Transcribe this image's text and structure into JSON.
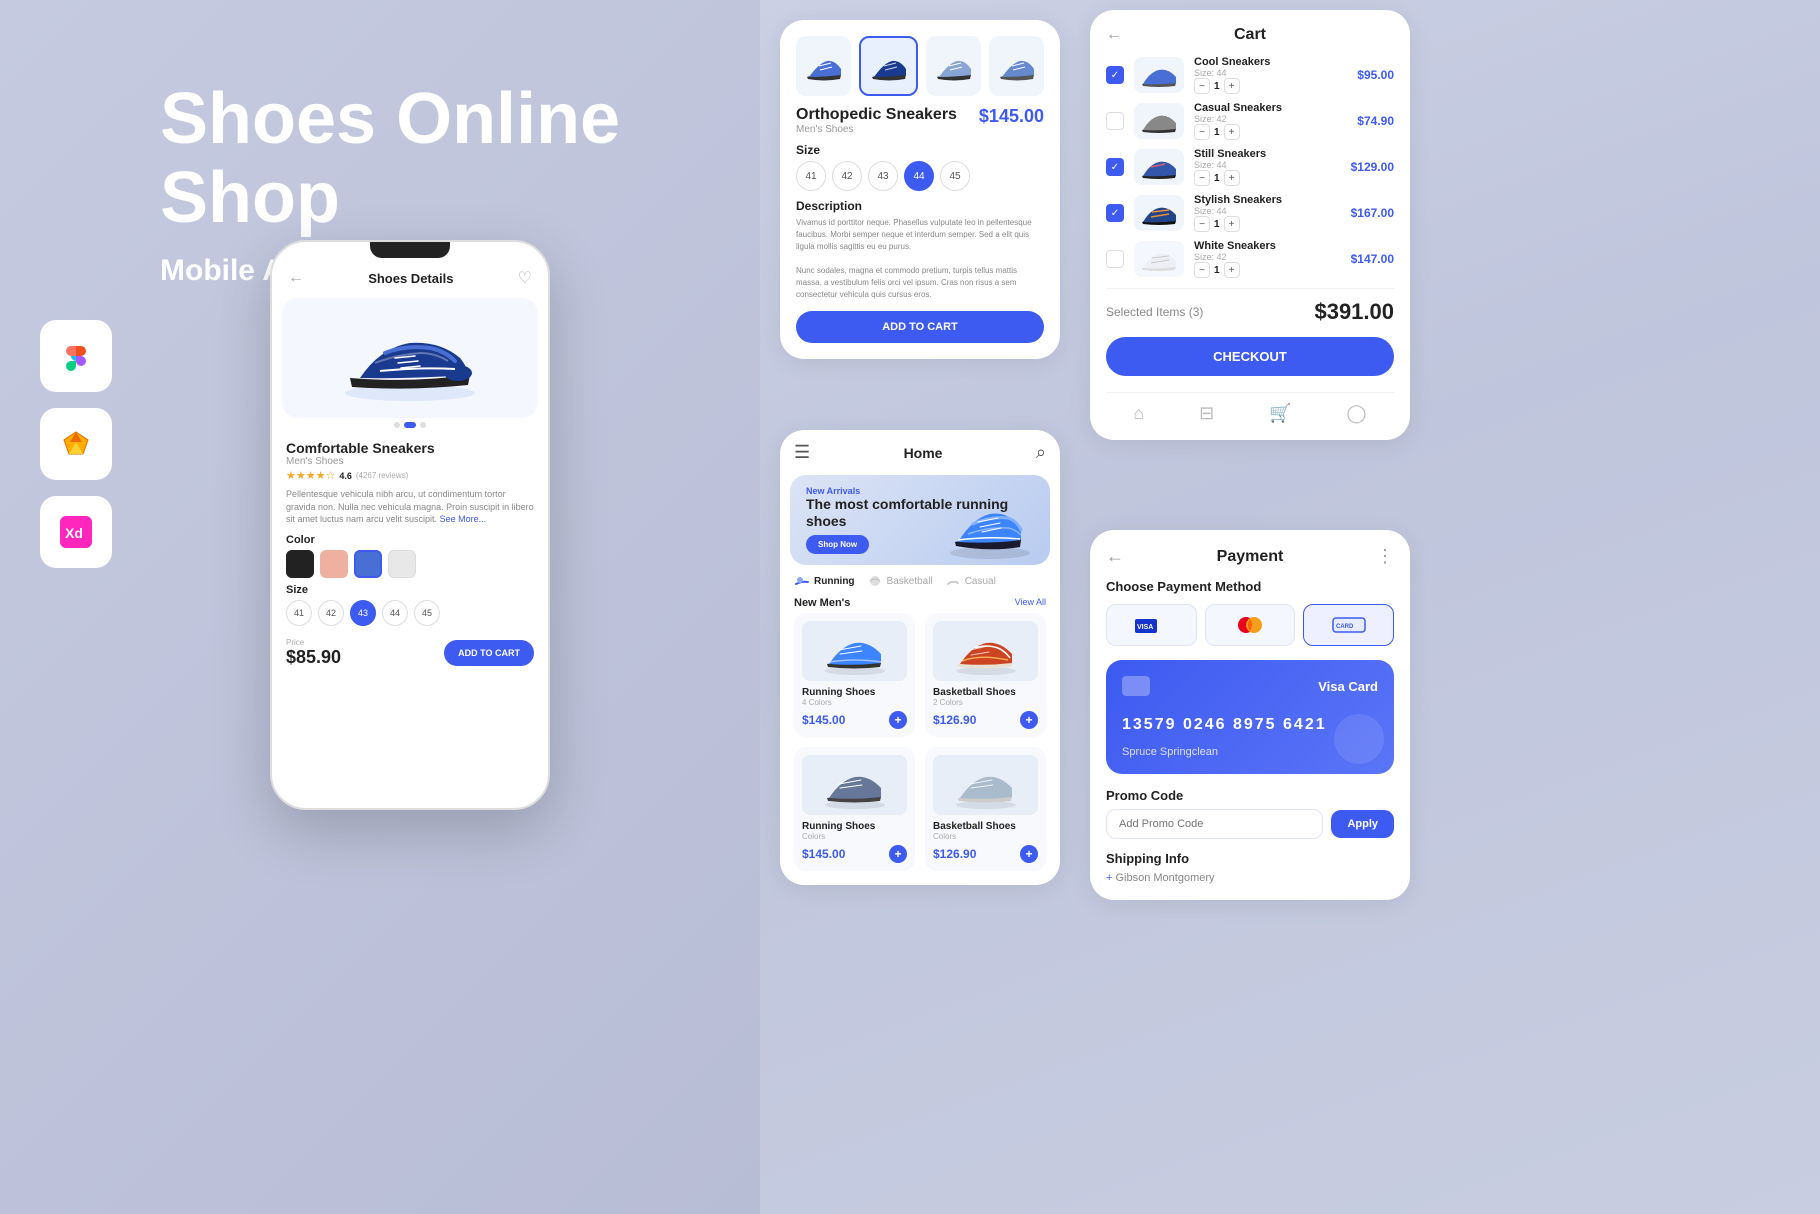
{
  "hero": {
    "title": "Shoes Online Shop",
    "subtitle": "Mobile App UI Kit"
  },
  "tools": [
    {
      "name": "Figma",
      "icon": "🎨",
      "class": "tool-figma"
    },
    {
      "name": "Sketch",
      "icon": "💎",
      "class": "tool-sketch"
    },
    {
      "name": "XD",
      "icon": "✦",
      "class": "tool-xd"
    }
  ],
  "phone_detail": {
    "screen_title": "Shoes Details",
    "product_name": "Comfortable Sneakers",
    "category": "Men's Shoes",
    "rating": "4.6",
    "review_count": "(4267 reviews)",
    "description": "Pellentesque vehicula nibh arcu, ut condimentum tortor gravida non. Nulla nec vehicula magna. Proin suscipit in libero sit amet luctus nam arcu velit suscipit.",
    "see_more": "See More...",
    "color_label": "Color",
    "size_label": "Size",
    "sizes": [
      "41",
      "42",
      "43",
      "44",
      "45"
    ],
    "selected_size": "43",
    "price_label": "Price",
    "price": "$85.90",
    "add_to_cart": "ADD TO CART"
  },
  "product_detail_card": {
    "product_name": "Orthopedic Sneakers",
    "category": "Men's Shoes",
    "price": "$145.00",
    "size_label": "Size",
    "sizes": [
      "41",
      "42",
      "43",
      "44",
      "45"
    ],
    "active_size": "44",
    "description_label": "Description",
    "description": "Vivamus id porttitor neque. Phasellus vulputate leo in pellentesque faucibus. Morbi semper neque et interdum semper. Sed a elit quis ligula mollis sagittis eu eu purus.\n\nNunc sodales, magna et commodo pretium, turpis tellus mattis massa, a vestibulum felis orci vel ipsum. Cras non risus a sem consectetur vehicula quis cursus eros.",
    "add_to_cart": "ADD TO CART"
  },
  "home_screen": {
    "title": "Home",
    "banner": {
      "new_label": "New Arrivals",
      "headline": "The most comfortable running shoes",
      "button": "Shop Now"
    },
    "categories": [
      "Running",
      "Basketball",
      "Casual"
    ],
    "new_mens_label": "New Men's",
    "view_all": "View All",
    "products": [
      {
        "name": "Running Shoes",
        "colors": "4 Colors",
        "price": "$145.00"
      },
      {
        "name": "Basketball Shoes",
        "colors": "2 Colors",
        "price": "$126.90"
      },
      {
        "name": "Running Shoes",
        "colors": "Colors",
        "price": "$145.00"
      },
      {
        "name": "Basketball Shoes",
        "colors": "Colors",
        "price": "$126.90"
      }
    ]
  },
  "cart_screen": {
    "title": "Cart",
    "items": [
      {
        "name": "Cool Sneakers",
        "size": "Size: 44",
        "price": "$95.00",
        "qty": "1",
        "checked": true
      },
      {
        "name": "Casual Sneakers",
        "size": "Size: 42",
        "price": "$74.90",
        "qty": "1",
        "checked": false
      },
      {
        "name": "Still Sneakers",
        "size": "Size: 44",
        "price": "$129.00",
        "qty": "1",
        "checked": true
      },
      {
        "name": "Stylish Sneakers",
        "size": "Size: 44",
        "price": "$167.00",
        "qty": "1",
        "checked": true
      },
      {
        "name": "White Sneakers",
        "size": "Size: 42",
        "price": "$147.00",
        "qty": "1",
        "checked": false
      }
    ],
    "selected_label": "Selected Items (3)",
    "total": "$391.00",
    "checkout_label": "CHECKOUT"
  },
  "payment_screen": {
    "title": "Payment",
    "method_label": "Choose Payment Method",
    "visa_label": "Visa Card",
    "card_number": "13579  0246  8975  6421",
    "card_holder": "Spruce Springclean",
    "promo_label": "Promo Code",
    "promo_placeholder": "Add Promo Code",
    "apply_label": "Apply",
    "shipping_label": "Shipping Info",
    "shipping_name": "Gibson Montgomery"
  }
}
